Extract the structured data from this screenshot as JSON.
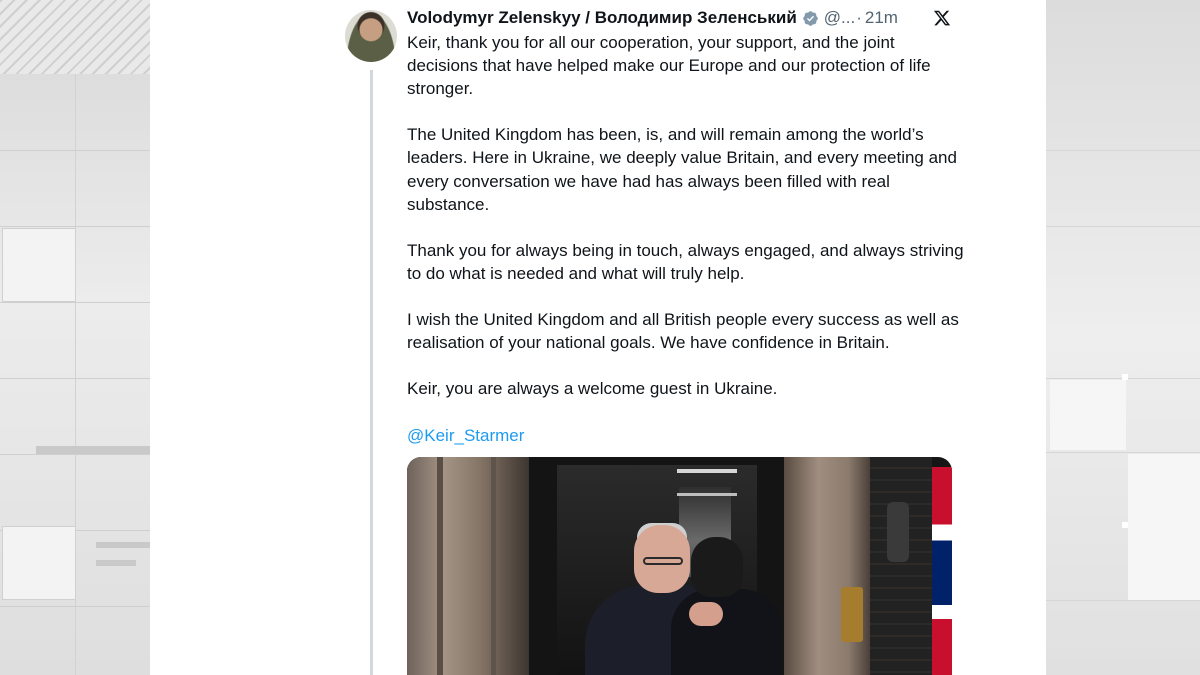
{
  "tweet": {
    "author_name": "Volodymyr Zelenskyy / Володимир Зеленський",
    "handle": "@...",
    "separator": "·",
    "timestamp": "21m",
    "verified_icon": "verified-badge-icon",
    "platform_icon": "x-logo-icon",
    "paragraphs": [
      "Keir, thank you for all our cooperation, your support, and the joint decisions that have helped make our Europe and our protection of life stronger.",
      "The United Kingdom has been, is, and will remain among the world’s leaders. Here in Ukraine, we deeply value Britain, and every meeting and every conversation we have had has always been filled with real substance.",
      "Thank you for always being in touch, always engaged, and always striving to do what is needed and what will truly help.",
      "I wish the United Kingdom and all British people every success as well as realisation of your national goals. We have confidence in Britain.",
      "Keir, you are always a welcome guest in Ukraine."
    ],
    "mention": "@Keir_Starmer"
  },
  "colors": {
    "text": "#0f1419",
    "secondary": "#536471",
    "link": "#1d9bf0",
    "thread_line": "#cfd9de"
  }
}
